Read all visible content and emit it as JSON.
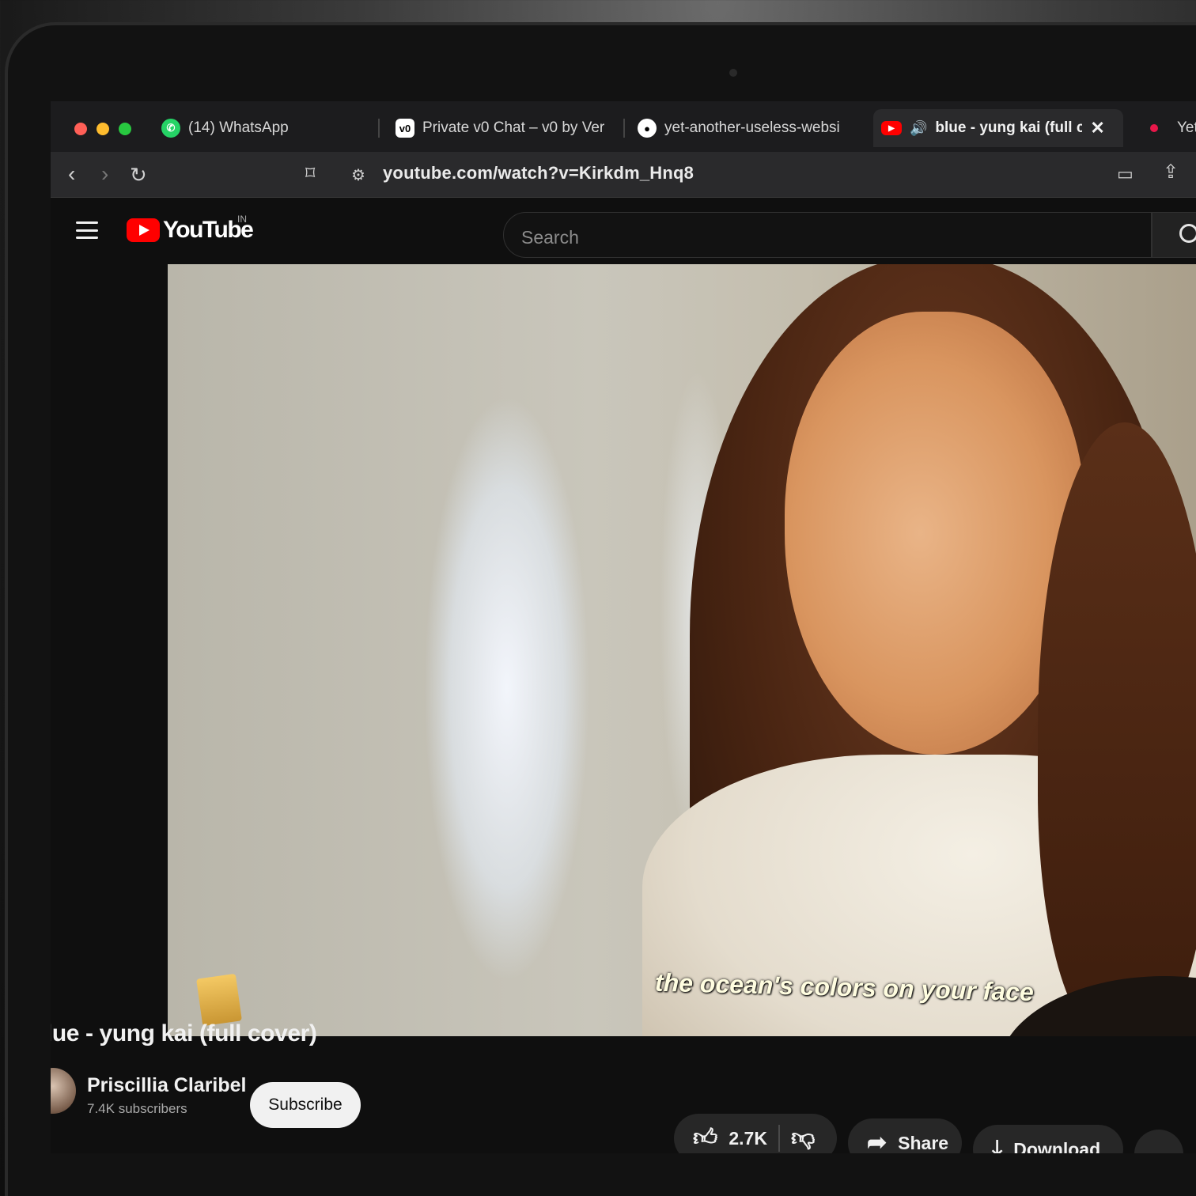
{
  "browser": {
    "tabs": [
      {
        "label": "(14) WhatsApp",
        "favicon": "whatsapp-icon",
        "color": "#25d366"
      },
      {
        "label": "Private v0 Chat – v0 by Ver",
        "favicon": "v0-icon",
        "color": "#ffffff"
      },
      {
        "label": "yet-another-useless-websi",
        "favicon": "github-icon",
        "color": "#ffffff"
      },
      {
        "label": "blue - yung kai (full c",
        "favicon": "youtube-icon",
        "color": "#ff0000",
        "active": true
      },
      {
        "label": "Yet",
        "favicon": "dot-icon",
        "color": "#e8174a"
      }
    ],
    "url": "youtube.com/watch?v=Kirkdm_Hnq8"
  },
  "youtube": {
    "logo_text": "YouTube",
    "country": "IN",
    "search_placeholder": "Search"
  },
  "video": {
    "caption": "the ocean's colors on your face",
    "title": "blue - yung kai (full cover)",
    "channel": "Priscillia Claribel",
    "subscribers": "7.4K subscribers",
    "subscribe_label": "Subscribe",
    "likes": "2.7K",
    "share_label": "Share",
    "download_label": "Download",
    "more_label": "..."
  },
  "colors": {
    "accent": "#ff0000",
    "background": "#0f0f0f"
  }
}
